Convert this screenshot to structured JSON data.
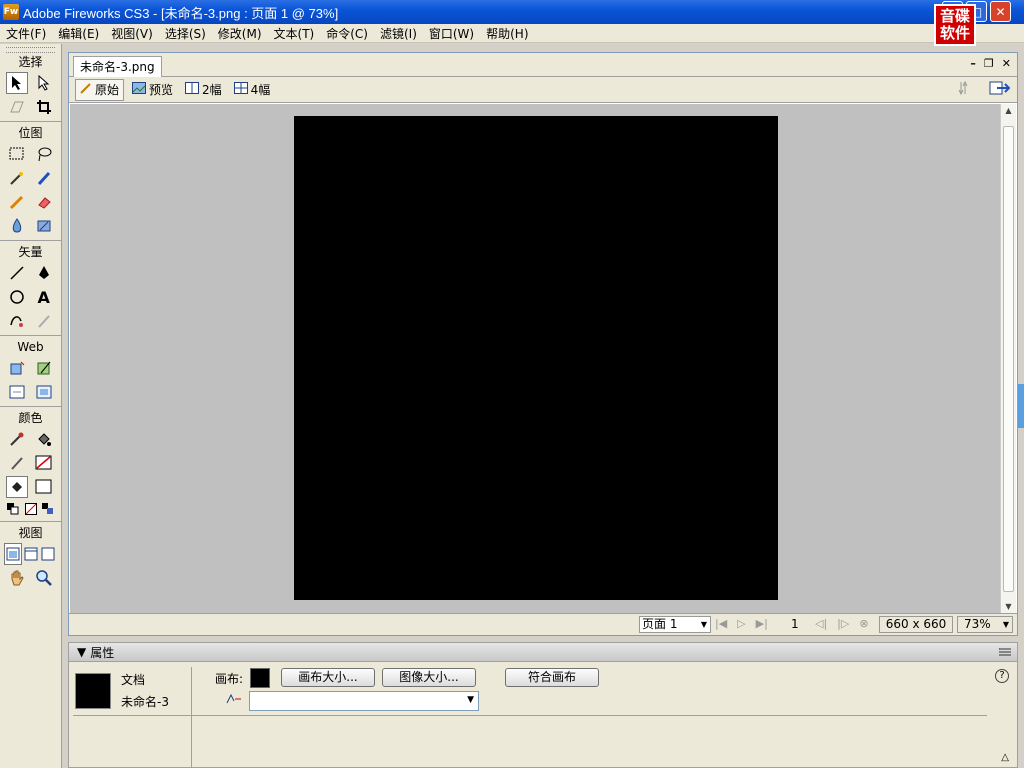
{
  "window": {
    "app_icon": "Fw",
    "title": "Adobe Fireworks CS3 - [未命名-3.png : 页面 1 @  73%]",
    "brand_logo": [
      "音碟",
      "软件"
    ]
  },
  "menubar": {
    "items": [
      "文件(F)",
      "编辑(E)",
      "视图(V)",
      "选择(S)",
      "修改(M)",
      "文本(T)",
      "命令(C)",
      "滤镜(I)",
      "窗口(W)",
      "帮助(H)"
    ]
  },
  "tools": {
    "sections": {
      "select": "选择",
      "bitmap": "位图",
      "vector": "矢量",
      "web": "Web",
      "colors": "颜色",
      "view": "视图"
    },
    "text_tool_glyph": "A"
  },
  "document": {
    "tab_label": "未命名-3.png",
    "view_buttons": {
      "original": "原始",
      "preview": "预览",
      "two_up": "2幅",
      "four_up": "4幅"
    },
    "status": {
      "page": "页面 1",
      "frame": "1",
      "size": "660 x 660",
      "zoom": "73%"
    }
  },
  "properties": {
    "header": "属性",
    "doc_type": "文档",
    "doc_name": "未命名-3",
    "canvas_label": "画布:",
    "canvas_size_button": "画布大小...",
    "image_size_button": "图像大小...",
    "fit_canvas_button": "符合画布",
    "help_glyph": "?"
  },
  "colors": {
    "titlebar": "#0a55d8",
    "canvas": "#000000",
    "stage": "#c0c0c0",
    "panel": "#ece9d8"
  }
}
